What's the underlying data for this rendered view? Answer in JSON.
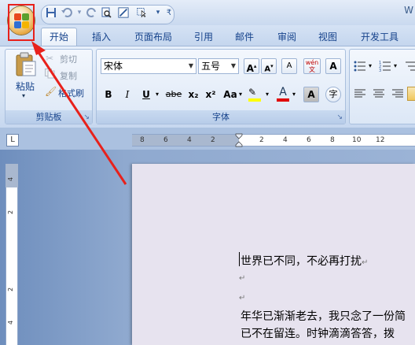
{
  "title_bar": {
    "app_title_fragment": "W"
  },
  "tabs": [
    "开始",
    "插入",
    "页面布局",
    "引用",
    "邮件",
    "审阅",
    "视图",
    "开发工具"
  ],
  "clipboard": {
    "paste_label": "粘贴",
    "cut_label": "剪切",
    "copy_label": "复制",
    "format_painter_label": "格式刷",
    "group_label": "剪贴板"
  },
  "font": {
    "font_name": "宋体",
    "font_size": "五号",
    "bold": "B",
    "italic": "I",
    "underline": "U",
    "strike": "abe",
    "subscript": "x₂",
    "superscript": "x²",
    "change_case": "Aa",
    "grow_font": "A",
    "shrink_font": "A",
    "clear_format": "A",
    "phonetic": "wén 文",
    "char_border": "A",
    "char_shading": "A",
    "enclose_char": "字",
    "font_color": "A",
    "group_label": "字体",
    "highlight_color": "#ffff00",
    "font_color_value": "#e00000"
  },
  "ruler": {
    "corner_symbol": "L",
    "h_ticks": [
      "8",
      "6",
      "4",
      "2",
      "2",
      "4",
      "6",
      "8",
      "10",
      "12"
    ],
    "v_ticks": [
      "4",
      "2",
      "2",
      "4"
    ]
  },
  "document": {
    "line1": "世界已不同，不必再打扰",
    "para_mark": "↵",
    "line4": "年华已渐渐老去，我只念了一份简",
    "line5": "已不在留连。时钟滴滴答答，拨"
  },
  "colors": {
    "highlight_box": "#e8211b",
    "arrow": "#e8211b"
  }
}
